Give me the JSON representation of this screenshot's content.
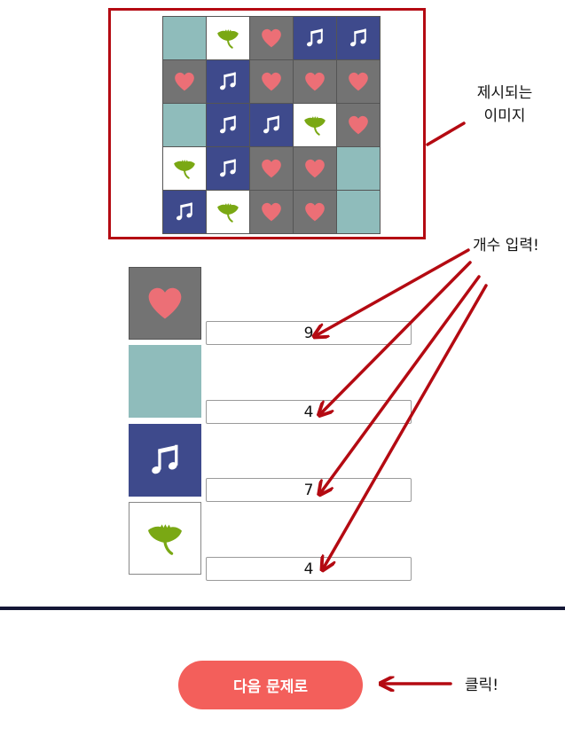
{
  "presented_image": {
    "grid": [
      [
        "teal",
        "leaf",
        "heart",
        "music",
        "music"
      ],
      [
        "heart",
        "music",
        "heart",
        "heart",
        "heart"
      ],
      [
        "teal",
        "music",
        "music",
        "leaf",
        "heart"
      ],
      [
        "leaf",
        "music",
        "heart",
        "heart",
        "teal"
      ],
      [
        "music",
        "leaf",
        "heart",
        "heart",
        "teal"
      ]
    ],
    "icons": {
      "heart": "heart-icon",
      "music": "music-note-icon",
      "leaf": "ginkgo-leaf-icon",
      "teal": "blank-teal-tile"
    },
    "colors": {
      "heart_bg": "#737373",
      "heart_fg": "#ec6f76",
      "teal_bg": "#8fbcbb",
      "music_bg": "#3e4a8c",
      "music_fg": "#ffffff",
      "leaf_bg": "#ffffff",
      "leaf_fg": "#7aa814"
    }
  },
  "answers": [
    {
      "tile": "heart",
      "value": "9"
    },
    {
      "tile": "teal",
      "value": "4"
    },
    {
      "tile": "music",
      "value": "7"
    },
    {
      "tile": "leaf",
      "value": "4"
    }
  ],
  "annotations": {
    "presented_image_label_line1": "제시되는",
    "presented_image_label_line2": "이미지",
    "count_input_label": "개수 입력!",
    "click_label": "클릭!",
    "arrow_color": "#b40a12"
  },
  "next_button": {
    "label": "다음 문제로",
    "color": "#f35f5b"
  }
}
